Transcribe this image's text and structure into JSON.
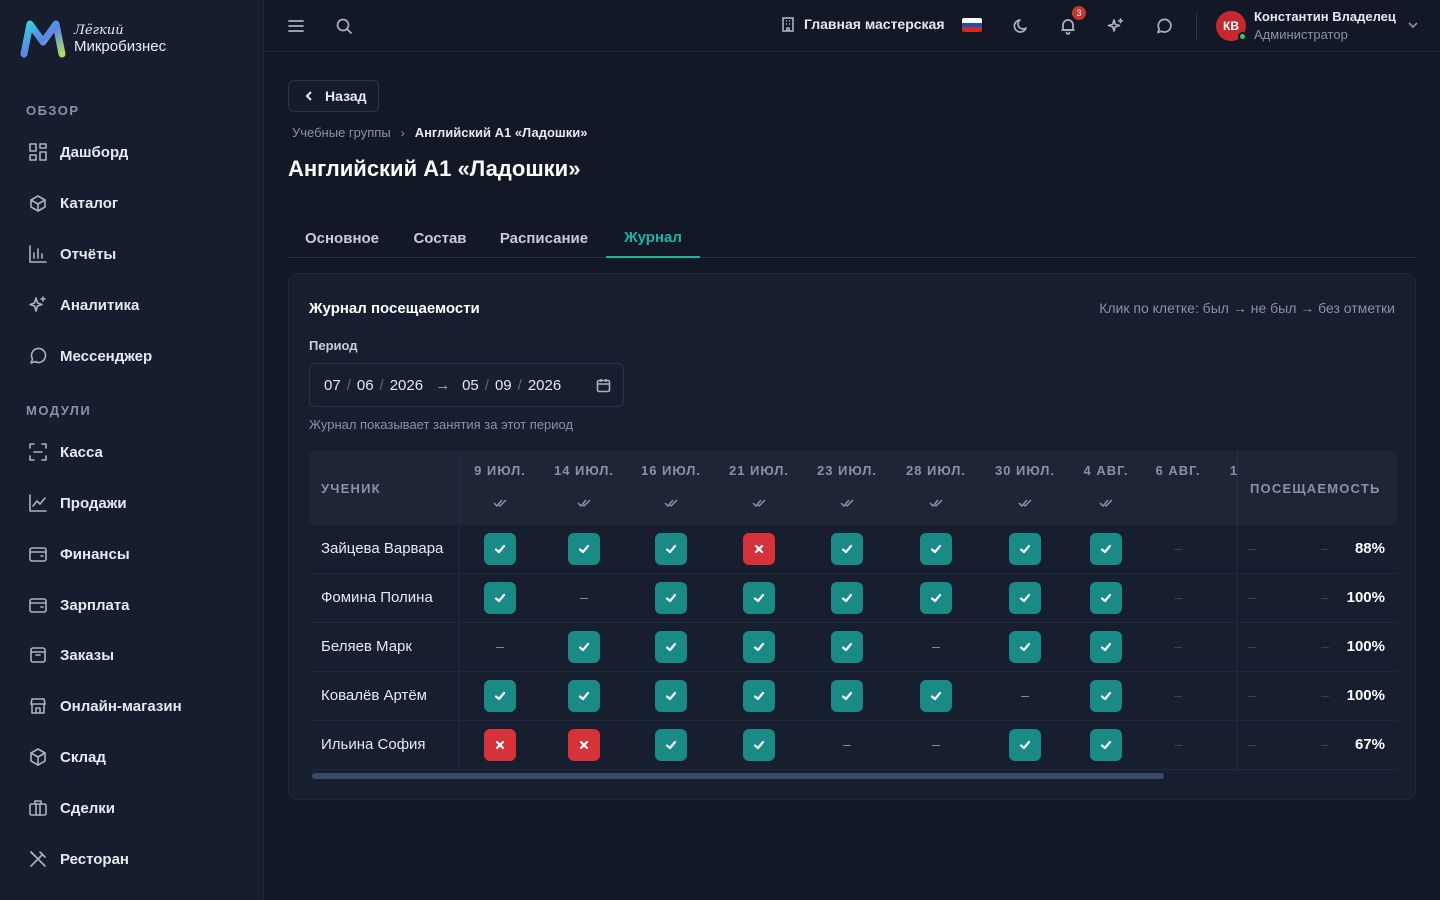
{
  "brand": {
    "top": "Лёгкий",
    "bottom": "Микробизнес"
  },
  "sidebar": {
    "sections": [
      {
        "title": "ОБЗОР",
        "items": [
          {
            "label": "Дашборд",
            "icon": "dashboard-icon"
          },
          {
            "label": "Каталог",
            "icon": "catalog-icon"
          },
          {
            "label": "Отчёты",
            "icon": "reports-icon"
          },
          {
            "label": "Аналитика",
            "icon": "sparkle-icon"
          },
          {
            "label": "Мессенджер",
            "icon": "chat-icon"
          }
        ]
      },
      {
        "title": "МОДУЛИ",
        "items": [
          {
            "label": "Касса",
            "icon": "scan-icon"
          },
          {
            "label": "Продажи",
            "icon": "chart-line-icon"
          },
          {
            "label": "Финансы",
            "icon": "wallet-icon"
          },
          {
            "label": "Зарплата",
            "icon": "wallet-icon"
          },
          {
            "label": "Заказы",
            "icon": "package-icon"
          },
          {
            "label": "Онлайн-магазин",
            "icon": "store-icon"
          },
          {
            "label": "Склад",
            "icon": "box-icon"
          },
          {
            "label": "Сделки",
            "icon": "briefcase-icon"
          },
          {
            "label": "Ресторан",
            "icon": "utensils-icon"
          }
        ]
      }
    ]
  },
  "header": {
    "workspace": "Главная мастерская",
    "notifications_count": "3",
    "user": {
      "initials": "КВ",
      "name": "Константин Владелец",
      "role": "Администратор"
    }
  },
  "page": {
    "back_label": "Назад",
    "breadcrumb": [
      "Учебные группы",
      "Английский А1 «Ладошки»"
    ],
    "title": "Английский А1 «Ладошки»",
    "tabs": [
      {
        "label": "Основное",
        "active": false
      },
      {
        "label": "Состав",
        "active": false
      },
      {
        "label": "Расписание",
        "active": false
      },
      {
        "label": "Журнал",
        "active": true
      }
    ]
  },
  "journal": {
    "title": "Журнал посещаемости",
    "hint": "Клик по клетке: был → не был → без отметки",
    "period_label": "Период",
    "period_from": {
      "d": "07",
      "m": "06",
      "y": "2026"
    },
    "period_to": {
      "d": "05",
      "m": "09",
      "y": "2026"
    },
    "period_note": "Журнал показывает занятия за этот период",
    "col_student": "УЧЕНИК",
    "col_attendance": "ПОСЕЩАЕМОСТЬ",
    "dates": [
      "9 ИЮЛ.",
      "14 ИЮЛ.",
      "16 ИЮЛ.",
      "21 ИЮЛ.",
      "23 ИЮЛ.",
      "28 ИЮЛ.",
      "30 ИЮЛ.",
      "4 АВГ.",
      "6 АВГ.",
      "1"
    ],
    "rows": [
      {
        "name": "Зайцева Варвара",
        "marks": [
          "yes",
          "yes",
          "yes",
          "no",
          "yes",
          "yes",
          "yes",
          "yes",
          "none",
          "none"
        ],
        "pct": "88%"
      },
      {
        "name": "Фомина Полина",
        "marks": [
          "yes",
          "none",
          "yes",
          "yes",
          "yes",
          "yes",
          "yes",
          "yes",
          "none",
          "none"
        ],
        "pct": "100%"
      },
      {
        "name": "Беляев Марк",
        "marks": [
          "none",
          "yes",
          "yes",
          "yes",
          "yes",
          "none",
          "yes",
          "yes",
          "none",
          "none"
        ],
        "pct": "100%"
      },
      {
        "name": "Ковалёв Артём",
        "marks": [
          "yes",
          "yes",
          "yes",
          "yes",
          "yes",
          "yes",
          "none",
          "yes",
          "none",
          "none"
        ],
        "pct": "100%"
      },
      {
        "name": "Ильина София",
        "marks": [
          "no",
          "no",
          "yes",
          "yes",
          "none",
          "none",
          "yes",
          "yes",
          "none",
          "none"
        ],
        "pct": "67%"
      }
    ]
  }
}
